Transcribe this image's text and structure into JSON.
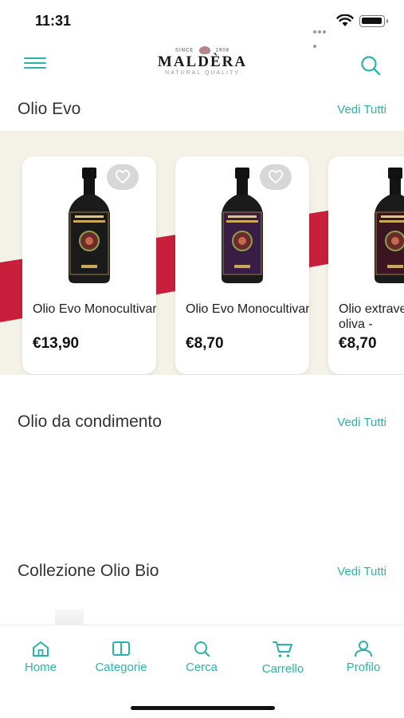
{
  "status_bar": {
    "time": "11:31"
  },
  "header": {
    "logo": {
      "since": "SINCE",
      "year": "1908",
      "brand": "MALDÈRA",
      "tagline": "NATURAL QUALITY"
    }
  },
  "sections": [
    {
      "title": "Olio Evo",
      "link": "Vedi Tutti",
      "products": [
        {
          "name": "Olio Evo Monocultivar",
          "price": "€13,90",
          "label_color": "#1a1a1a"
        },
        {
          "name": "Olio Evo Monocultivar",
          "price": "€8,70",
          "label_color": "#3a1d44"
        },
        {
          "name": "Olio extravergine di oliva -",
          "price": "€8,70",
          "label_color": "#3b1620"
        }
      ]
    },
    {
      "title": "Olio da condimento",
      "link": "Vedi Tutti"
    },
    {
      "title": "Collezione Olio Bio",
      "link": "Vedi Tutti"
    }
  ],
  "tabbar": [
    {
      "label": "Home",
      "icon": "home-icon"
    },
    {
      "label": "Categorie",
      "icon": "book-icon"
    },
    {
      "label": "Cerca",
      "icon": "search-icon"
    },
    {
      "label": "Carrello",
      "icon": "cart-icon"
    },
    {
      "label": "Profilo",
      "icon": "user-icon"
    }
  ],
  "colors": {
    "accent": "#2bb3a8",
    "band": "#f4f1e6",
    "stripe": "#c8203c"
  }
}
